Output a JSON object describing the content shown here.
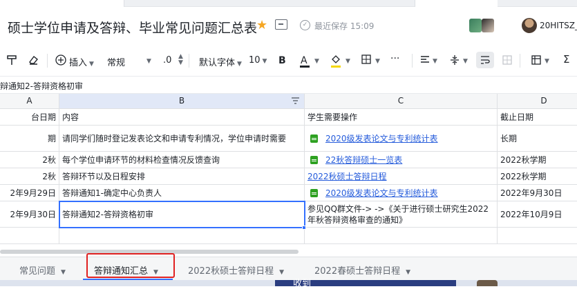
{
  "document": {
    "title": "硕士学位申请及答辩、毕业常见问题汇总表",
    "save_status": "最近保存 15:09",
    "user_name": "20HITSZ_"
  },
  "toolbar": {
    "insert_label": "插入",
    "format_label": "常规",
    "decimal_label": ".0",
    "font_label": "默认字体",
    "font_size": "10",
    "bold_label": "B",
    "font_color_label": "A",
    "more_label": "···",
    "sum_label": "Σ"
  },
  "formula_bar": {
    "value": "辩通知2-答辩资格初审"
  },
  "columns": [
    {
      "letter": "A"
    },
    {
      "letter": "B"
    },
    {
      "letter": "C"
    },
    {
      "letter": "D"
    }
  ],
  "rows": [
    {
      "a": "台日期",
      "b": "内容",
      "c": "学生需要操作",
      "d": "截止日期"
    },
    {
      "a": "期",
      "b": "请同学们随时登记发表论文和申请专利情况，学位申请时需要",
      "c": "2020级发表论文与专利统计表",
      "d": "长期"
    },
    {
      "a": "2秋",
      "b": "每个学位申请环节的材料检查情况反馈查询",
      "c": "22秋答辩硕士一览表",
      "d": "2022秋学期"
    },
    {
      "a": "2秋",
      "b": "答辩环节以及日程安排",
      "c": "2022秋硕士答辩日程",
      "d": "2022秋学期"
    },
    {
      "a": "2年9月29日",
      "b": "答辩通知1-确定中心负责人",
      "c": "2020级发表论文与专利统计表",
      "d": "2022年9月30日"
    },
    {
      "a": "2年9月30日",
      "b": "答辩通知2-答辩资格初审",
      "c": "参见QQ群文件-> ->《关于进行硕士研究生2022年秋答辩资格审查的通知》",
      "d": "2022年10月9日"
    }
  ],
  "sheet_tabs": [
    {
      "label": "常见问题",
      "active": false
    },
    {
      "label": "答辩通知汇总",
      "active": true
    },
    {
      "label": "2022秋硕士答辩日程",
      "active": false
    },
    {
      "label": "2022春硕士答辩日程",
      "active": false
    }
  ],
  "taskbar": {
    "partial_text": "收到"
  },
  "colors": {
    "accent": "#3370ff",
    "link": "#245bdb",
    "star": "#f5a623",
    "sheet_icon": "#2ea121",
    "highlight_box": "#e02020"
  }
}
